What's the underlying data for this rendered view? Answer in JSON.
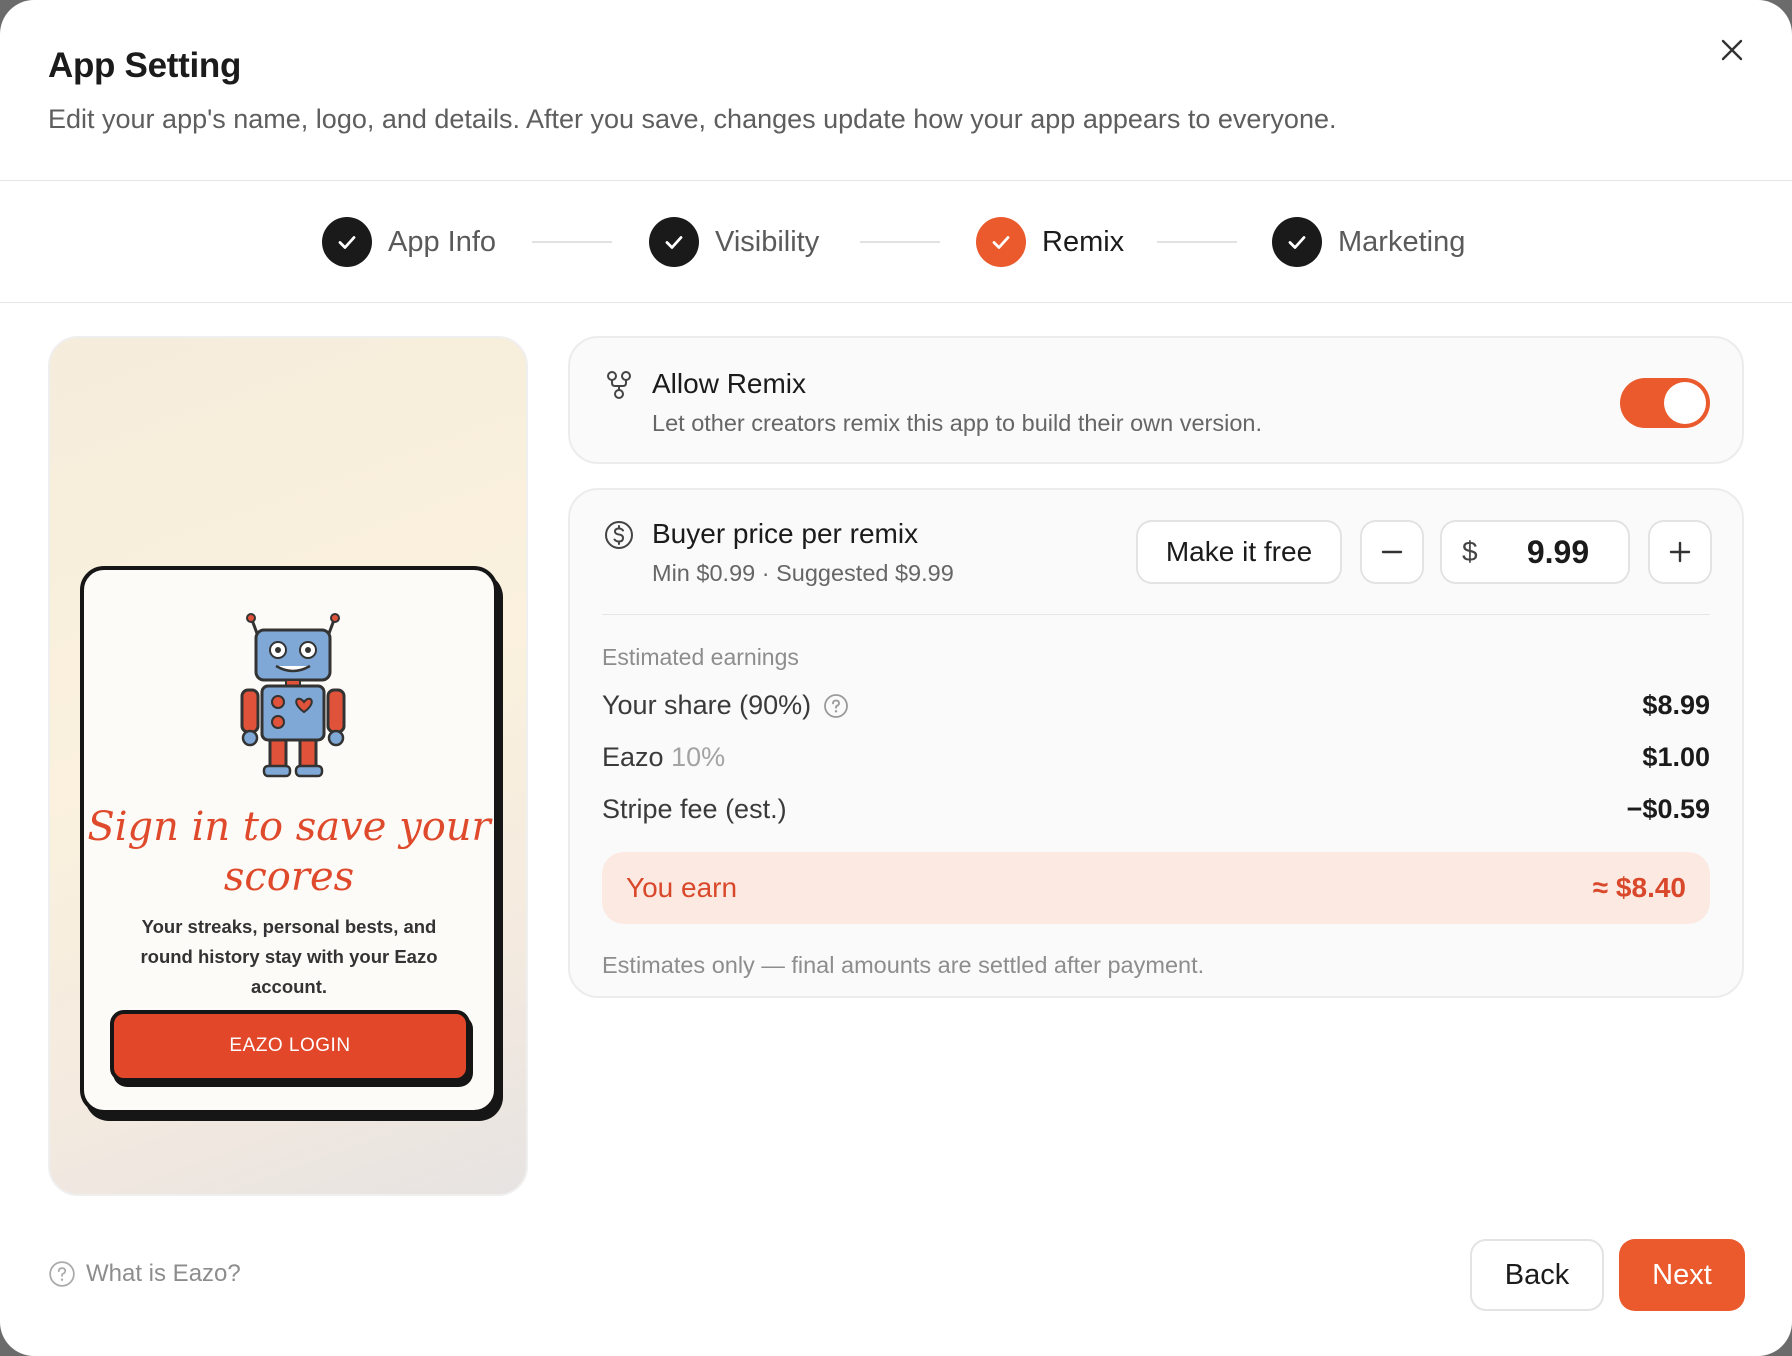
{
  "dialog": {
    "title": "App Setting",
    "subtitle": "Edit your app's name, logo, and details. After you save, changes update how your app appears to everyone.",
    "close_icon": "close-icon"
  },
  "steps": [
    {
      "label": "App Info",
      "state": "done"
    },
    {
      "label": "Visibility",
      "state": "done"
    },
    {
      "label": "Remix",
      "state": "active"
    },
    {
      "label": "Marketing",
      "state": "done"
    }
  ],
  "preview": {
    "title": "Sign in to save your scores",
    "text": "Your streaks, personal bests, and round history stay with your Eazo account.",
    "button": "EAZO LOGIN",
    "image": "robot-illustration"
  },
  "remix": {
    "icon": "fork-icon",
    "title": "Allow Remix",
    "description": "Let other creators remix this app to build their own version.",
    "enabled": true
  },
  "pricing": {
    "icon": "dollar-circle-icon",
    "title": "Buyer price per remix",
    "hint": "Min $0.99 · Suggested $9.99",
    "free_button": "Make it free",
    "currency": "$",
    "price": "9.99",
    "estimated_label": "Estimated earnings",
    "share_label": "Your share (90%)",
    "share_value": "$8.99",
    "eazo_label": "Eazo",
    "eazo_pct": "10%",
    "eazo_value": "$1.00",
    "stripe_label": "Stripe fee (est.)",
    "stripe_value": "−$0.59",
    "earn_label": "You earn",
    "earn_value": "≈ $8.40",
    "footnote": "Estimates only — final amounts are settled after payment."
  },
  "footer": {
    "help": "What is Eazo?",
    "back": "Back",
    "next": "Next"
  },
  "colors": {
    "accent": "#ea5a2c",
    "done": "#1a1a1a",
    "earn_bg": "#fce9e2"
  }
}
